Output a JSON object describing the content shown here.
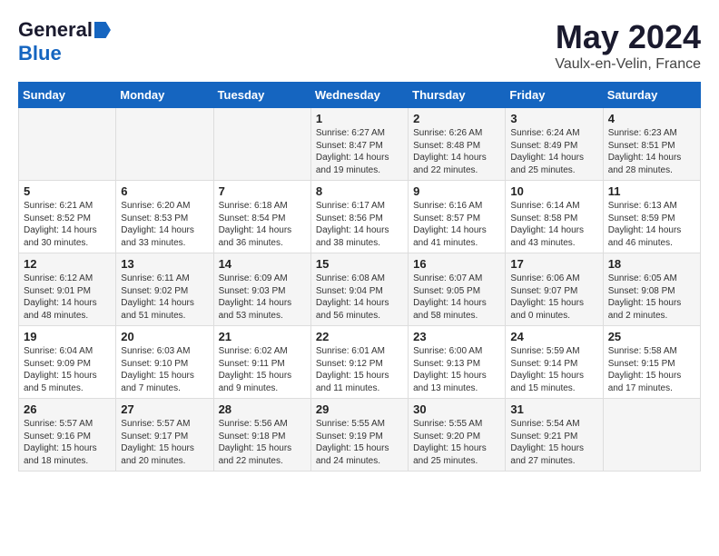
{
  "header": {
    "logo_general": "General",
    "logo_blue": "Blue",
    "month": "May 2024",
    "location": "Vaulx-en-Velin, France"
  },
  "days_of_week": [
    "Sunday",
    "Monday",
    "Tuesday",
    "Wednesday",
    "Thursday",
    "Friday",
    "Saturday"
  ],
  "weeks": [
    [
      {
        "day": "",
        "info": ""
      },
      {
        "day": "",
        "info": ""
      },
      {
        "day": "",
        "info": ""
      },
      {
        "day": "1",
        "info": "Sunrise: 6:27 AM\nSunset: 8:47 PM\nDaylight: 14 hours\nand 19 minutes."
      },
      {
        "day": "2",
        "info": "Sunrise: 6:26 AM\nSunset: 8:48 PM\nDaylight: 14 hours\nand 22 minutes."
      },
      {
        "day": "3",
        "info": "Sunrise: 6:24 AM\nSunset: 8:49 PM\nDaylight: 14 hours\nand 25 minutes."
      },
      {
        "day": "4",
        "info": "Sunrise: 6:23 AM\nSunset: 8:51 PM\nDaylight: 14 hours\nand 28 minutes."
      }
    ],
    [
      {
        "day": "5",
        "info": "Sunrise: 6:21 AM\nSunset: 8:52 PM\nDaylight: 14 hours\nand 30 minutes."
      },
      {
        "day": "6",
        "info": "Sunrise: 6:20 AM\nSunset: 8:53 PM\nDaylight: 14 hours\nand 33 minutes."
      },
      {
        "day": "7",
        "info": "Sunrise: 6:18 AM\nSunset: 8:54 PM\nDaylight: 14 hours\nand 36 minutes."
      },
      {
        "day": "8",
        "info": "Sunrise: 6:17 AM\nSunset: 8:56 PM\nDaylight: 14 hours\nand 38 minutes."
      },
      {
        "day": "9",
        "info": "Sunrise: 6:16 AM\nSunset: 8:57 PM\nDaylight: 14 hours\nand 41 minutes."
      },
      {
        "day": "10",
        "info": "Sunrise: 6:14 AM\nSunset: 8:58 PM\nDaylight: 14 hours\nand 43 minutes."
      },
      {
        "day": "11",
        "info": "Sunrise: 6:13 AM\nSunset: 8:59 PM\nDaylight: 14 hours\nand 46 minutes."
      }
    ],
    [
      {
        "day": "12",
        "info": "Sunrise: 6:12 AM\nSunset: 9:01 PM\nDaylight: 14 hours\nand 48 minutes."
      },
      {
        "day": "13",
        "info": "Sunrise: 6:11 AM\nSunset: 9:02 PM\nDaylight: 14 hours\nand 51 minutes."
      },
      {
        "day": "14",
        "info": "Sunrise: 6:09 AM\nSunset: 9:03 PM\nDaylight: 14 hours\nand 53 minutes."
      },
      {
        "day": "15",
        "info": "Sunrise: 6:08 AM\nSunset: 9:04 PM\nDaylight: 14 hours\nand 56 minutes."
      },
      {
        "day": "16",
        "info": "Sunrise: 6:07 AM\nSunset: 9:05 PM\nDaylight: 14 hours\nand 58 minutes."
      },
      {
        "day": "17",
        "info": "Sunrise: 6:06 AM\nSunset: 9:07 PM\nDaylight: 15 hours\nand 0 minutes."
      },
      {
        "day": "18",
        "info": "Sunrise: 6:05 AM\nSunset: 9:08 PM\nDaylight: 15 hours\nand 2 minutes."
      }
    ],
    [
      {
        "day": "19",
        "info": "Sunrise: 6:04 AM\nSunset: 9:09 PM\nDaylight: 15 hours\nand 5 minutes."
      },
      {
        "day": "20",
        "info": "Sunrise: 6:03 AM\nSunset: 9:10 PM\nDaylight: 15 hours\nand 7 minutes."
      },
      {
        "day": "21",
        "info": "Sunrise: 6:02 AM\nSunset: 9:11 PM\nDaylight: 15 hours\nand 9 minutes."
      },
      {
        "day": "22",
        "info": "Sunrise: 6:01 AM\nSunset: 9:12 PM\nDaylight: 15 hours\nand 11 minutes."
      },
      {
        "day": "23",
        "info": "Sunrise: 6:00 AM\nSunset: 9:13 PM\nDaylight: 15 hours\nand 13 minutes."
      },
      {
        "day": "24",
        "info": "Sunrise: 5:59 AM\nSunset: 9:14 PM\nDaylight: 15 hours\nand 15 minutes."
      },
      {
        "day": "25",
        "info": "Sunrise: 5:58 AM\nSunset: 9:15 PM\nDaylight: 15 hours\nand 17 minutes."
      }
    ],
    [
      {
        "day": "26",
        "info": "Sunrise: 5:57 AM\nSunset: 9:16 PM\nDaylight: 15 hours\nand 18 minutes."
      },
      {
        "day": "27",
        "info": "Sunrise: 5:57 AM\nSunset: 9:17 PM\nDaylight: 15 hours\nand 20 minutes."
      },
      {
        "day": "28",
        "info": "Sunrise: 5:56 AM\nSunset: 9:18 PM\nDaylight: 15 hours\nand 22 minutes."
      },
      {
        "day": "29",
        "info": "Sunrise: 5:55 AM\nSunset: 9:19 PM\nDaylight: 15 hours\nand 24 minutes."
      },
      {
        "day": "30",
        "info": "Sunrise: 5:55 AM\nSunset: 9:20 PM\nDaylight: 15 hours\nand 25 minutes."
      },
      {
        "day": "31",
        "info": "Sunrise: 5:54 AM\nSunset: 9:21 PM\nDaylight: 15 hours\nand 27 minutes."
      },
      {
        "day": "",
        "info": ""
      }
    ]
  ]
}
